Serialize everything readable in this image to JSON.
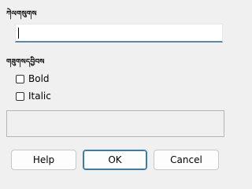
{
  "labels": {
    "name_section": "ཀེལགསུགས",
    "style_section": "གཟུགསདབྱིབས"
  },
  "name_input": {
    "value": ""
  },
  "options": {
    "bold_label": "Bold",
    "italic_label": "Italic",
    "bold_checked": false,
    "italic_checked": false
  },
  "preview": {
    "text": ""
  },
  "buttons": {
    "help": "Help",
    "ok": "OK",
    "cancel": "Cancel"
  }
}
